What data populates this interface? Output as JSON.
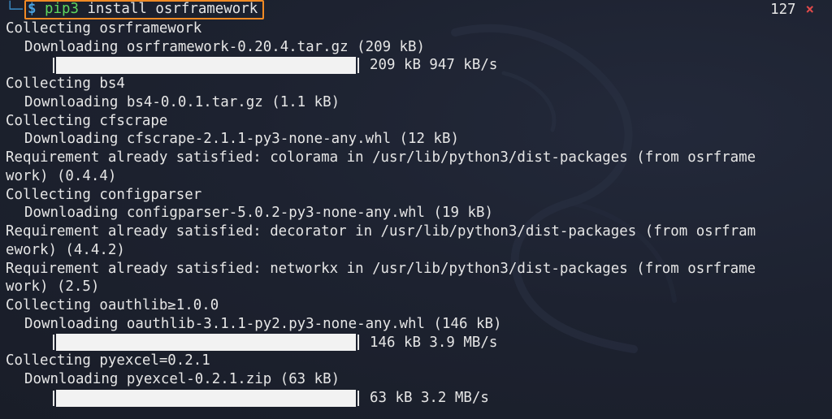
{
  "prompt": {
    "corner": "└─",
    "symbol": "$",
    "command_name": "pip3",
    "command_args": " install osrframework"
  },
  "status": {
    "exit_code": "127",
    "error_icon": "×",
    "error_color": "#e04a4a"
  },
  "colors": {
    "background": "#1b1f2a",
    "text": "#e6e6e6",
    "highlight_border": "#f08a24",
    "command": "#5fd75f",
    "prompt_symbol": "#4aa3e0"
  },
  "lines": [
    {
      "type": "text",
      "text": "Collecting osrframework"
    },
    {
      "type": "text",
      "indent": true,
      "text": "Downloading osrframework-0.20.4.tar.gz (209 kB)"
    },
    {
      "type": "progress",
      "progress": 1.0,
      "stats": "209 kB 947 kB/s"
    },
    {
      "type": "text",
      "text": "Collecting bs4"
    },
    {
      "type": "text",
      "indent": true,
      "text": "Downloading bs4-0.0.1.tar.gz (1.1 kB)"
    },
    {
      "type": "text",
      "text": "Collecting cfscrape"
    },
    {
      "type": "text",
      "indent": true,
      "text": "Downloading cfscrape-2.1.1-py3-none-any.whl (12 kB)"
    },
    {
      "type": "text",
      "text": "Requirement already satisfied: colorama in /usr/lib/python3/dist-packages (from osrframe"
    },
    {
      "type": "text",
      "text": "work) (0.4.4)"
    },
    {
      "type": "text",
      "text": "Collecting configparser"
    },
    {
      "type": "text",
      "indent": true,
      "text": "Downloading configparser-5.0.2-py3-none-any.whl (19 kB)"
    },
    {
      "type": "text",
      "text": "Requirement already satisfied: decorator in /usr/lib/python3/dist-packages (from osrfram"
    },
    {
      "type": "text",
      "text": "ework) (4.4.2)"
    },
    {
      "type": "text",
      "text": "Requirement already satisfied: networkx in /usr/lib/python3/dist-packages (from osrframe"
    },
    {
      "type": "text",
      "text": "work) (2.5)"
    },
    {
      "type": "text",
      "text": "Collecting oauthlib≥1.0.0"
    },
    {
      "type": "text",
      "indent": true,
      "text": "Downloading oauthlib-3.1.1-py2.py3-none-any.whl (146 kB)"
    },
    {
      "type": "progress",
      "progress": 1.0,
      "stats": "146 kB 3.9 MB/s"
    },
    {
      "type": "text",
      "text": "Collecting pyexcel=0.2.1"
    },
    {
      "type": "text",
      "indent": true,
      "text": "Downloading pyexcel-0.2.1.zip (63 kB)"
    },
    {
      "type": "progress",
      "progress": 1.0,
      "stats": "63 kB 3.2 MB/s"
    }
  ]
}
